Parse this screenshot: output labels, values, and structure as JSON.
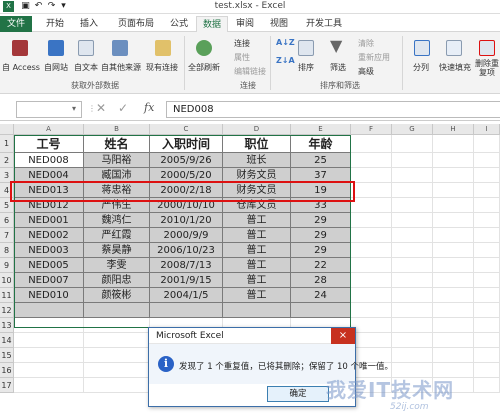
{
  "window": {
    "title": "test.xlsx - Excel"
  },
  "tabs": [
    "文件",
    "开始",
    "插入",
    "页面布局",
    "公式",
    "数据",
    "审阅",
    "视图",
    "开发工具"
  ],
  "ribbon": {
    "external": [
      "自 Access",
      "自网站",
      "自文本",
      "自其他来源",
      "现有连接"
    ],
    "refresh": "全部刷新",
    "connections": [
      "连接",
      "属性",
      "编辑链接"
    ],
    "sort": [
      "排序",
      "筛选"
    ],
    "filter_small": [
      "清除",
      "重新应用",
      "高级"
    ],
    "tools": [
      "分列",
      "快速填充",
      "删除重复项"
    ],
    "groups": [
      "获取外部数据",
      "连接",
      "排序和筛选"
    ]
  },
  "formula_bar": {
    "name_box": "",
    "fx": "fx",
    "value": "NED008"
  },
  "columns": [
    "A",
    "B",
    "C",
    "D",
    "E",
    "F",
    "G",
    "H",
    "I"
  ],
  "rows": [
    "1",
    "2",
    "3",
    "4",
    "5",
    "6",
    "7",
    "8",
    "9",
    "10",
    "11",
    "12",
    "13",
    "14",
    "15",
    "16",
    "17"
  ],
  "table": {
    "headers": [
      "工号",
      "姓名",
      "入职时间",
      "职位",
      "年龄"
    ],
    "data": [
      [
        "NED008",
        "马阳裕",
        "2005/9/26",
        "班长",
        "25"
      ],
      [
        "NED004",
        "臧国沛",
        "2000/5/20",
        "财务文员",
        "37"
      ],
      [
        "NED013",
        "蒋忠裕",
        "2000/2/18",
        "财务文员",
        "19"
      ],
      [
        "NED012",
        "严伟生",
        "2000/10/10",
        "仓库文员",
        "33"
      ],
      [
        "NED001",
        "魏鸿仁",
        "2010/1/20",
        "普工",
        "29"
      ],
      [
        "NED002",
        "严红霞",
        "2000/9/9",
        "普工",
        "29"
      ],
      [
        "NED003",
        "蔡昊静",
        "2006/10/23",
        "普工",
        "29"
      ],
      [
        "NED005",
        "李雯",
        "2008/7/13",
        "普工",
        "22"
      ],
      [
        "NED007",
        "颜阳忠",
        "2001/9/15",
        "普工",
        "28"
      ],
      [
        "NED010",
        "颜筱彬",
        "2004/1/5",
        "普工",
        "24"
      ]
    ]
  },
  "dialog": {
    "title": "Microsoft Excel",
    "close": "×",
    "message": "发现了 1 个重复值，已将其删除；保留了 10 个唯一值。",
    "ok": "确定"
  },
  "watermark": {
    "text": "我爱IT技术网",
    "sub": "52ij.com"
  }
}
